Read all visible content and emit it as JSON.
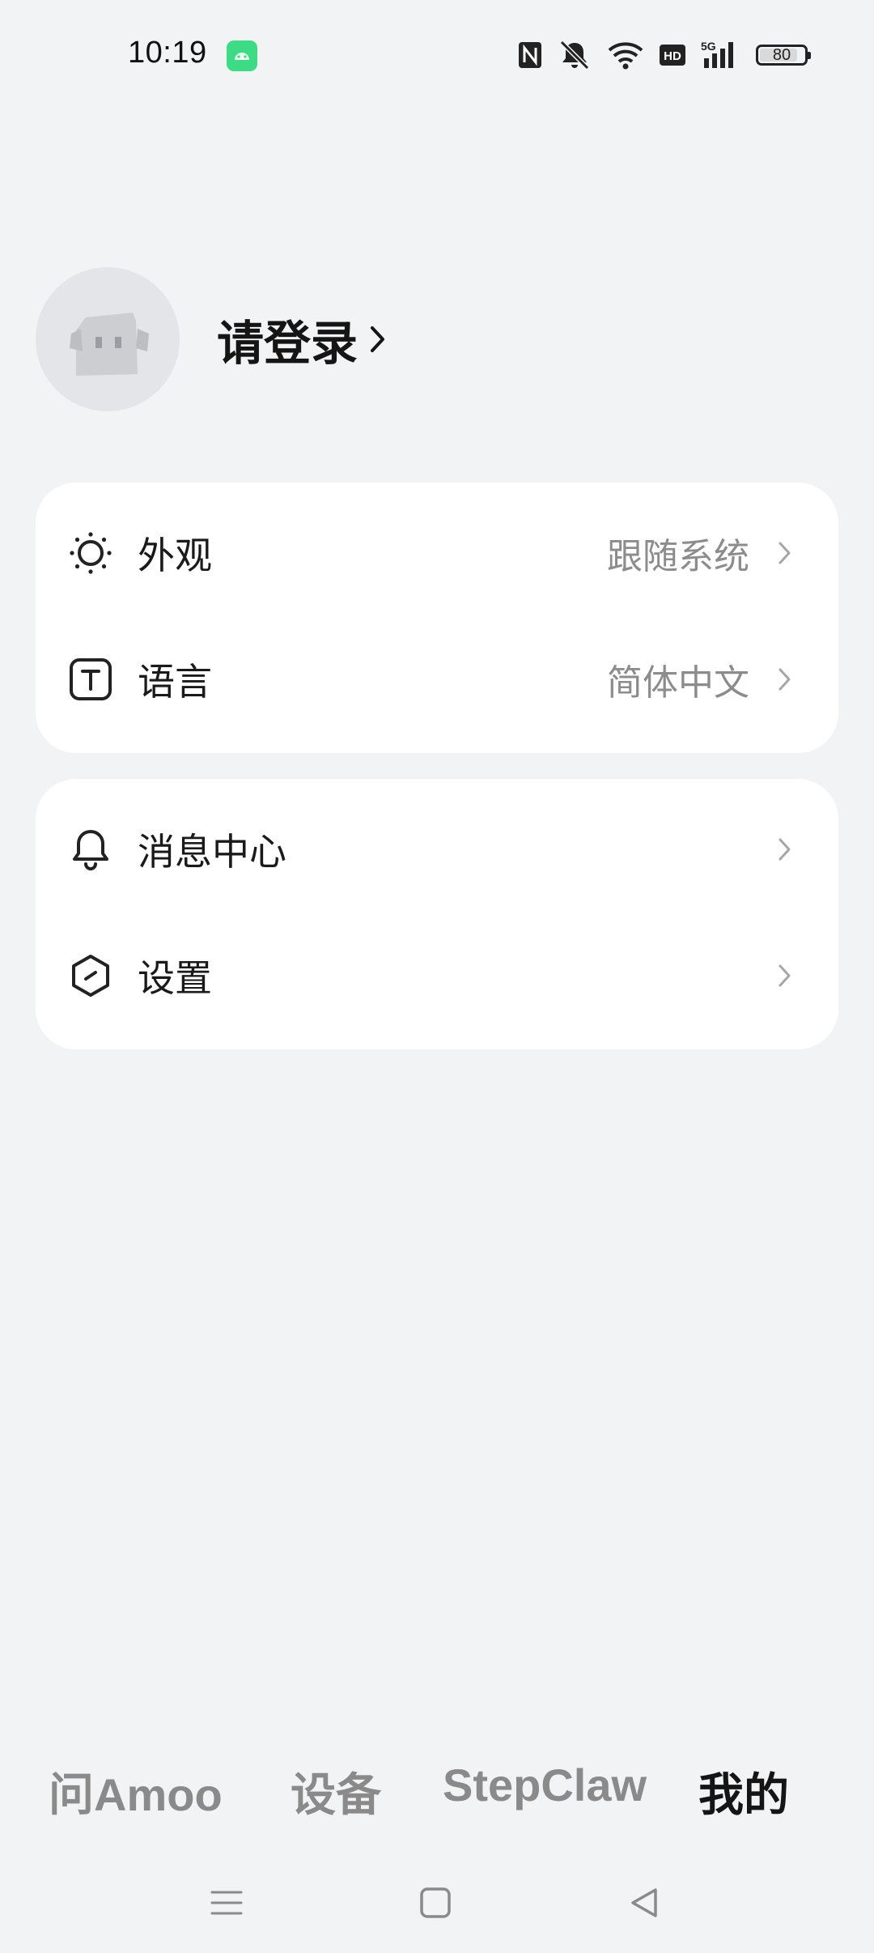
{
  "status_bar": {
    "time": "10:19",
    "icons": [
      "android-app-icon",
      "nfc-icon",
      "silent-bell-icon",
      "wifi-icon",
      "hd-icon",
      "5g-signal-icon"
    ],
    "battery_level": "80"
  },
  "profile": {
    "login_label": "请登录"
  },
  "card_general": {
    "appearance": {
      "icon": "sun-icon",
      "label": "外观",
      "value": "跟随系统"
    },
    "language": {
      "icon": "text-t-icon",
      "label": "语言",
      "value": "简体中文"
    }
  },
  "card_misc": {
    "messages": {
      "icon": "bell-icon",
      "label": "消息中心"
    },
    "settings": {
      "icon": "hexagon-icon",
      "label": "设置"
    }
  },
  "tabs": [
    {
      "label": "问Amoo",
      "active": false
    },
    {
      "label": "设备",
      "active": false
    },
    {
      "label": "StepClaw",
      "active": false
    },
    {
      "label": "我的",
      "active": true
    }
  ],
  "nav_bar": {
    "icons": [
      "menu-icon",
      "home-square-icon",
      "back-triangle-icon"
    ]
  },
  "colors": {
    "background": "#F2F3F5",
    "card": "#FFFFFF",
    "text_primary": "#1A1A1A",
    "text_secondary": "#8C8C8C",
    "tab_inactive": "#8A8A8A"
  }
}
